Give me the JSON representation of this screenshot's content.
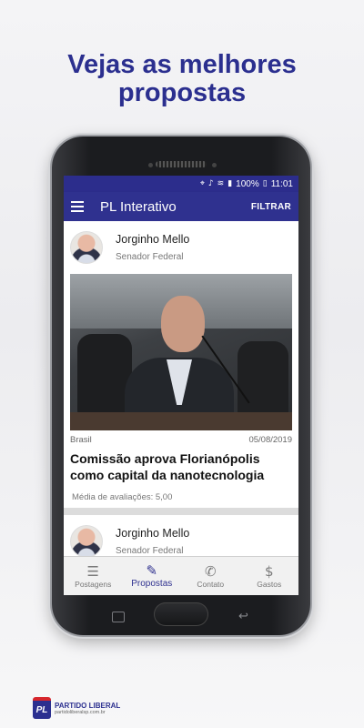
{
  "promo": {
    "headline_line1": "Vejas as melhores",
    "headline_line2": "propostas"
  },
  "status_bar": {
    "battery": "100%",
    "time": "11:01",
    "icons": [
      "location-icon",
      "sound-icon",
      "wifi-icon",
      "data-icon",
      "signal-icon",
      "battery-icon"
    ]
  },
  "app_bar": {
    "menu_icon": "hamburger-icon",
    "title": "PL Interativo",
    "filter_label": "FILTRAR"
  },
  "posts": [
    {
      "author_name": "Jorginho Mello",
      "author_role": "Senador Federal",
      "category": "Brasil",
      "date": "05/08/2019",
      "title": "Comissão aprova Florianópolis como capital da nanotecnologia",
      "rating_label": "Média de avaliações: 5,00"
    },
    {
      "author_name": "Jorginho Mello",
      "author_role": "Senador Federal"
    }
  ],
  "bottom_nav": [
    {
      "label": "Postagens",
      "icon": "list-icon",
      "active": false
    },
    {
      "label": "Propostas",
      "icon": "clipboard-icon",
      "active": true
    },
    {
      "label": "Contato",
      "icon": "whatsapp-icon",
      "active": false
    },
    {
      "label": "Gastos",
      "icon": "money-search-icon",
      "active": false
    }
  ],
  "footer_logo": {
    "mark": "PL",
    "name": "PARTIDO LIBERAL",
    "url": "partidoliberalsp.com.br"
  },
  "colors": {
    "brand_blue": "#2f318f",
    "logo_red": "#d6262c"
  }
}
